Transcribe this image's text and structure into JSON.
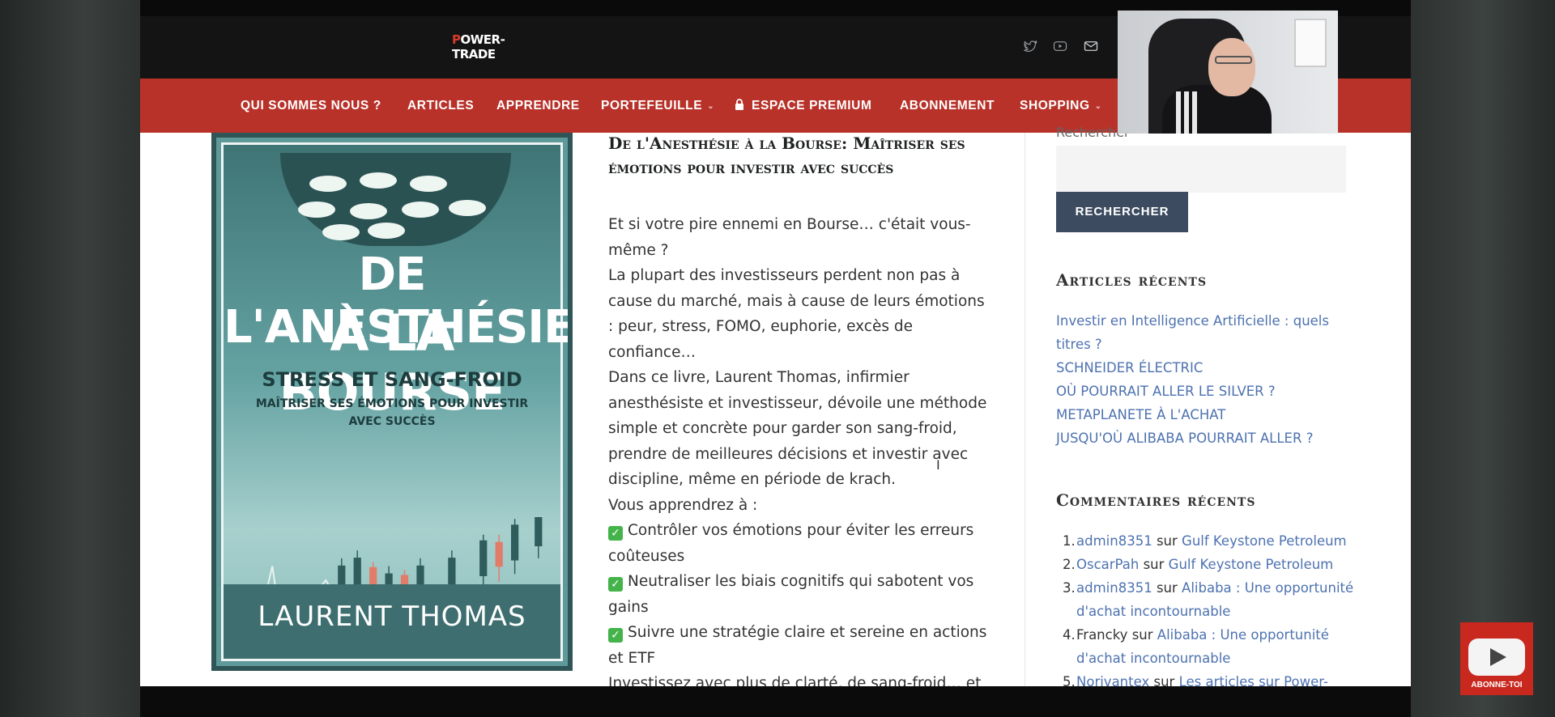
{
  "header": {
    "logo_text": "OWER-TRADE",
    "logo_initial": "P"
  },
  "nav": {
    "items": [
      {
        "label": "QUI SOMMES NOUS ?"
      },
      {
        "label": "ARTICLES"
      },
      {
        "label": "APPRENDRE"
      },
      {
        "label": "PORTEFEUILLE",
        "has_dropdown": true
      },
      {
        "label": "ESPACE PREMIUM",
        "icon": "lock-icon"
      },
      {
        "label": "ABONNEMENT"
      },
      {
        "label": "SHOPPING",
        "has_dropdown": true
      }
    ]
  },
  "social": [
    "twitter-icon",
    "youtube-icon",
    "mail-icon"
  ],
  "book": {
    "title_line1": "DE L'ANESTHÉSIE",
    "title_line2": "À LA BOURSE",
    "subtitle": "STRESS ET SANG-FROID",
    "tagline1": "MAÎTRISER SES ÉMOTIONS POUR INVESTIR",
    "tagline2": "AVEC SUCCÈS",
    "author": "LAURENT THOMAS"
  },
  "article": {
    "title": "De l'Anesthésie à la Bourse: Maîtriser ses émotions pour investir avec succès",
    "intro1": "Et si votre pire ennemi en Bourse… c'était vous-même ?",
    "intro2": "La plupart des investisseurs perdent non pas à cause du marché, mais à cause de leurs émotions : peur, stress, FOMO, euphorie, excès de confiance…",
    "intro3": "Dans ce livre, Laurent Thomas, infirmier anesthésiste et investisseur, dévoile une méthode simple et concrète pour garder son sang-froid, prendre de meilleures décisions et investir avec discipline, même en période de krach.",
    "learn": "Vous apprendrez à :",
    "bullet1": "Contrôler vos émotions pour éviter les erreurs coûteuses",
    "bullet2": "Neutraliser les biais cognitifs qui sabotent vos gains",
    "bullet3": "Suivre une stratégie claire et sereine en actions et ETF",
    "closing": "Investissez avec plus de clarté, de sang-froid… et de résultats."
  },
  "sidebar": {
    "search_label": "Rechercher",
    "search_value": "",
    "search_button": "RECHERCHER",
    "recent_title": "Articles récents",
    "recent": [
      "Investir en Intelligence Artificielle : quels titres ?",
      "SCHNEIDER ÉLECTRIC",
      "OÙ POURRAIT ALLER LE SILVER ?",
      "METAPLANETE À L'ACHAT",
      "JUSQU'OÙ ALIBABA POURRAIT ALLER ?"
    ],
    "comments_title": "Commentaires récents",
    "comments": [
      {
        "num": "1.",
        "author": "admin8351",
        "author_link": true,
        "sep": "sur",
        "post": "Gulf Keystone Petroleum"
      },
      {
        "num": "2.",
        "author": "OscarPah",
        "author_link": true,
        "sep": "sur",
        "post": "Gulf Keystone Petroleum"
      },
      {
        "num": "3.",
        "author": "admin8351",
        "author_link": true,
        "sep": "sur",
        "post": "Alibaba : Une opportunité d'achat incontournable"
      },
      {
        "num": "4.",
        "author": "Francky",
        "author_link": false,
        "sep": "sur",
        "post": "Alibaba : Une opportunité d'achat incontournable"
      },
      {
        "num": "5.",
        "author": "Norivantex",
        "author_link": true,
        "sep": "sur",
        "post": "Les articles sur Power-"
      }
    ]
  },
  "subscribe": {
    "label": "ABONNE-TOI"
  }
}
